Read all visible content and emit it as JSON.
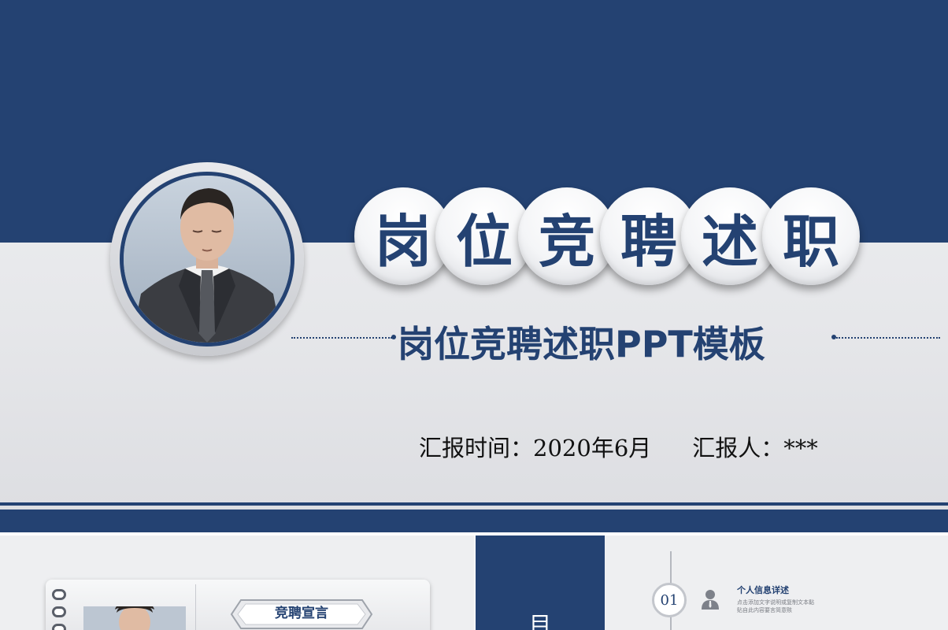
{
  "slide1": {
    "title_chars": [
      "岗",
      "位",
      "竞",
      "聘",
      "述",
      "职"
    ],
    "subtitle": "岗位竞聘述职PPT模板",
    "report_time_label": "汇报时间：",
    "report_time_value": "2020年6月",
    "reporter_label": "汇报人：",
    "reporter_value": "***"
  },
  "slide2": {
    "notebook_label": "竞聘宣言",
    "contents_char": "目",
    "items": [
      {
        "number": "01",
        "icon": "person-icon",
        "title": "个人信息详述",
        "description": "点击添加文字说明或复制文本黏贴自此内容要言简意赅"
      }
    ]
  },
  "colors": {
    "primary_navy": "#244272",
    "background_light": "#eeeff1",
    "text_dark": "#111111"
  }
}
